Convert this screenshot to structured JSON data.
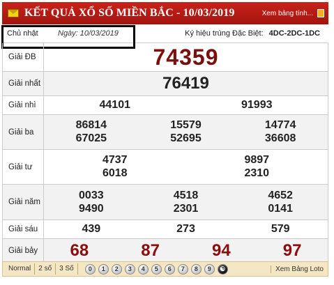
{
  "header": {
    "title": "KẾT QUẢ XỔ SỐ MIỀN BẮC - 10/03/2019",
    "more_link": "Xem bảng tính..."
  },
  "info": {
    "day": "Chủ nhật",
    "date": "Ngày: 10/03/2019",
    "kyhieu_label": "Ký hiệu trúng Đặc Biệt:",
    "kyhieu_value": "4DC-2DC-1DC"
  },
  "prizes": {
    "db": {
      "label": "Giải ĐB",
      "numbers": [
        "74359"
      ]
    },
    "nhat": {
      "label": "Giải nhất",
      "numbers": [
        "76419"
      ]
    },
    "nhi": {
      "label": "Giải nhì",
      "numbers": [
        "44101",
        "91993"
      ]
    },
    "ba": {
      "label": "Giải ba",
      "numbers": [
        "86814",
        "15579",
        "14774",
        "67025",
        "52695",
        "36608"
      ]
    },
    "tu": {
      "label": "Giải tư",
      "numbers": [
        "4737",
        "9897",
        "6018",
        "2310"
      ]
    },
    "nam": {
      "label": "Giải năm",
      "numbers": [
        "0033",
        "4518",
        "4652",
        "9490",
        "2301",
        "0141"
      ]
    },
    "sau": {
      "label": "Giải sáu",
      "numbers": [
        "439",
        "273",
        "579"
      ]
    },
    "bay": {
      "label": "Giải bảy",
      "numbers": [
        "68",
        "87",
        "94",
        "97"
      ]
    }
  },
  "footer": {
    "tabs": [
      "Normal",
      "2 số",
      "3 Số"
    ],
    "digits": [
      "0",
      "1",
      "2",
      "3",
      "4",
      "5",
      "6",
      "7",
      "8",
      "9",
      "☯"
    ],
    "loto_link": "Xem Bảng Loto"
  },
  "colors": {
    "header_bg": "#b81a12",
    "special_prize": "#7a0f0f",
    "footer_bg": "#f6e7c4"
  }
}
